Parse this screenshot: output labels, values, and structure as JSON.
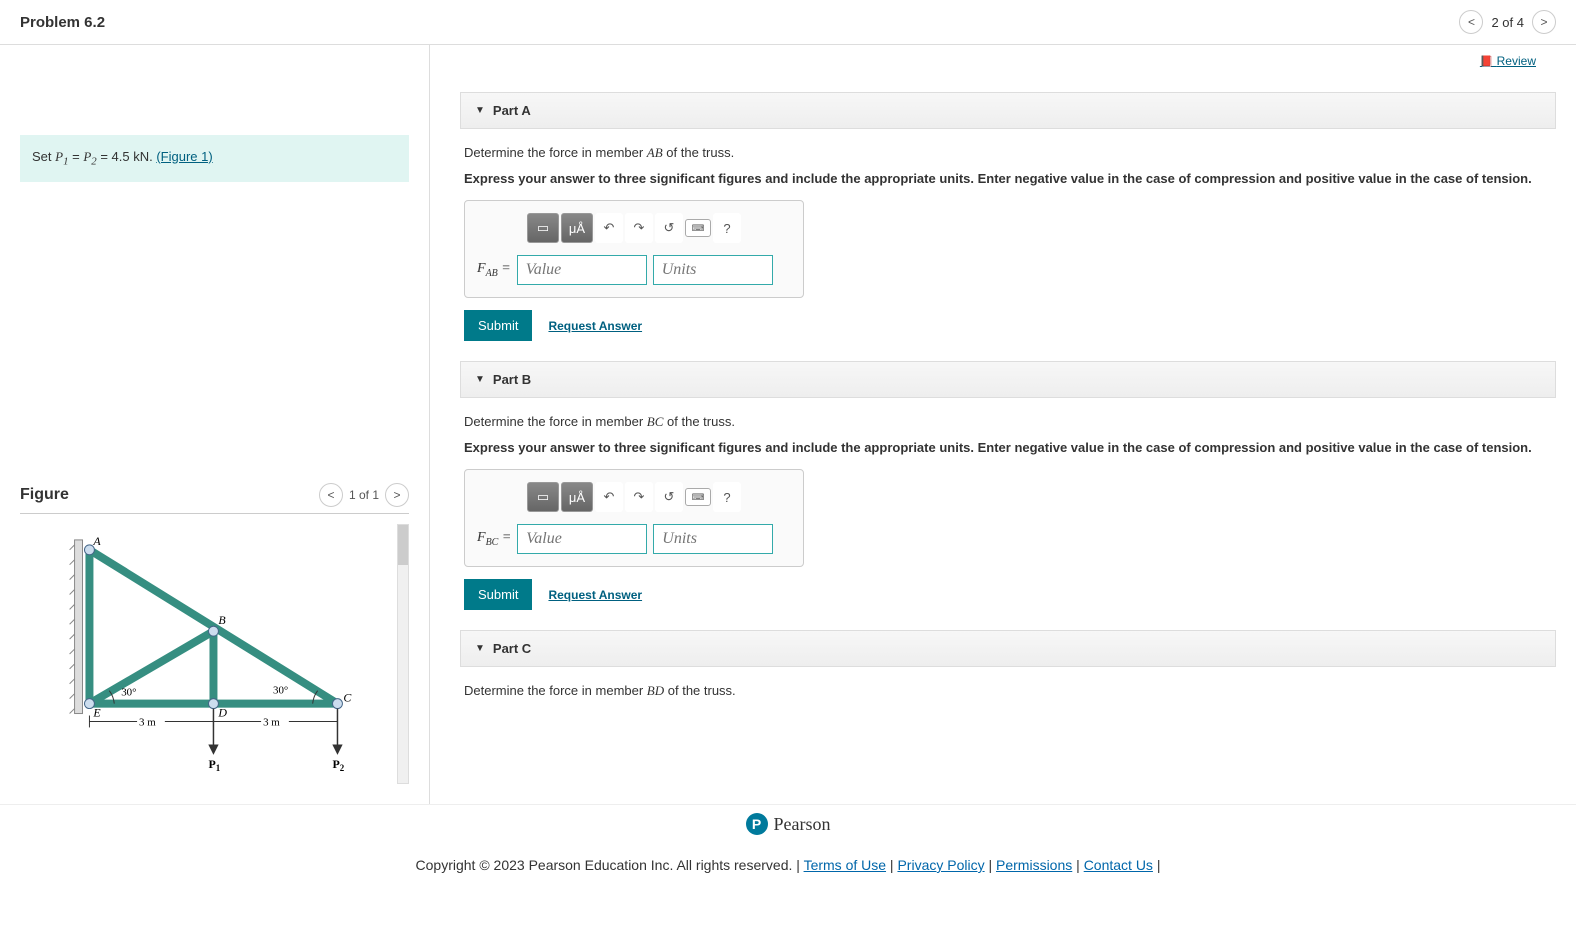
{
  "header": {
    "title": "Problem 6.2",
    "count": "2 of 4"
  },
  "review_label": "Review",
  "left": {
    "set_prefix": "Set ",
    "set_p1": "P",
    "set_eq": " = ",
    "set_p2": "P",
    "set_val": " = 4.5 kN. ",
    "figure_link": "(Figure 1)"
  },
  "figure": {
    "title": "Figure",
    "count": "1 of 1",
    "labels": {
      "A": "A",
      "B": "B",
      "C": "C",
      "D": "D",
      "E": "E",
      "ang1": "30°",
      "ang2": "30°",
      "dim1": "3 m",
      "dim2": "3 m",
      "P1": "P",
      "P2": "P"
    }
  },
  "parts": {
    "A": {
      "title": "Part A",
      "prompt_pre": "Determine the force in member ",
      "member": "AB",
      "prompt_post": " of the truss.",
      "bold": "Express your answer to three significant figures and include the appropriate units. Enter negative value in the case of compression and positive value in the case of tension.",
      "label_sub": "AB",
      "value_ph": "Value",
      "units_ph": "Units"
    },
    "B": {
      "title": "Part B",
      "prompt_pre": "Determine the force in member ",
      "member": "BC",
      "prompt_post": " of the truss.",
      "bold": "Express your answer to three significant figures and include the appropriate units. Enter negative value in the case of compression and positive value in the case of tension.",
      "label_sub": "BC",
      "value_ph": "Value",
      "units_ph": "Units"
    },
    "C": {
      "title": "Part C",
      "prompt_pre": "Determine the force in member ",
      "member": "BD",
      "prompt_post": " of the truss."
    }
  },
  "buttons": {
    "submit": "Submit",
    "request": "Request Answer"
  },
  "toolbar": {
    "templates": "▭",
    "greek": "μÅ",
    "undo": "↶",
    "redo": "↷",
    "reset": "↺",
    "keyboard": "⌨",
    "help": "?"
  },
  "footer": {
    "brand": "Pearson",
    "copyright": "Copyright © 2023 Pearson Education Inc. All rights reserved.",
    "links": {
      "terms": "Terms of Use",
      "privacy": "Privacy Policy",
      "permissions": "Permissions",
      "contact": "Contact Us"
    }
  }
}
